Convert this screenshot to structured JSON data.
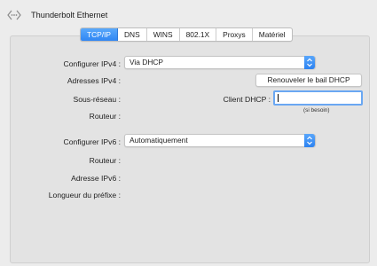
{
  "window": {
    "title": "Thunderbolt Ethernet"
  },
  "tabs": [
    {
      "label": "TCP/IP",
      "active": true
    },
    {
      "label": "DNS"
    },
    {
      "label": "WINS"
    },
    {
      "label": "802.1X"
    },
    {
      "label": "Proxys"
    },
    {
      "label": "Matériel"
    }
  ],
  "ipv4": {
    "configure_label": "Configurer IPv4 :",
    "configure_value": "Via DHCP",
    "addresses_label": "Adresses IPv4 :",
    "renew_button": "Renouveler le bail DHCP",
    "subnet_label": "Sous-réseau :",
    "dhcp_client_label": "Client DHCP :",
    "dhcp_client_value": "",
    "hint": "(si besoin)",
    "router_label": "Routeur :"
  },
  "ipv6": {
    "configure_label": "Configurer IPv6 :",
    "configure_value": "Automatiquement",
    "router_label": "Routeur :",
    "address_label": "Adresse IPv6 :",
    "prefix_label": "Longueur du préfixe :"
  },
  "colors": {
    "accent": "#2f86f3",
    "background": "#ececec",
    "panel": "#e3e3e3"
  },
  "icons": {
    "window": "network-dots-icon",
    "popup": "up-down-stepper-icon"
  }
}
